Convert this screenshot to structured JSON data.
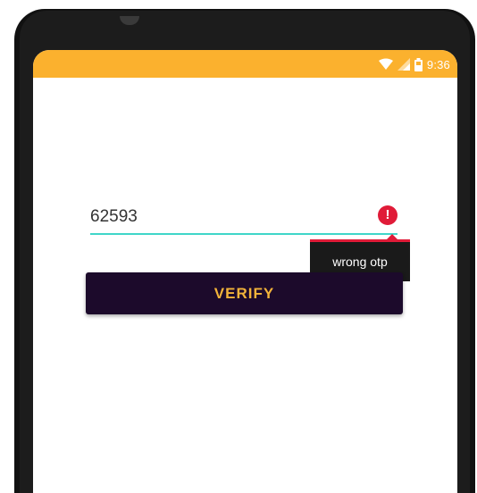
{
  "status_bar": {
    "time": "9:36",
    "icons": [
      "wifi-icon",
      "signal-icon",
      "battery-icon"
    ],
    "color": "#fbb12e"
  },
  "otp_field": {
    "value": "62593",
    "underline_color": "#3fd6c9",
    "error_icon_glyph": "!"
  },
  "error": {
    "message": "wrong otp",
    "color": "#e01b38"
  },
  "verify_button": {
    "label": "VERIFY",
    "background": "#1c0a2b",
    "text_color": "#f2b33a"
  }
}
